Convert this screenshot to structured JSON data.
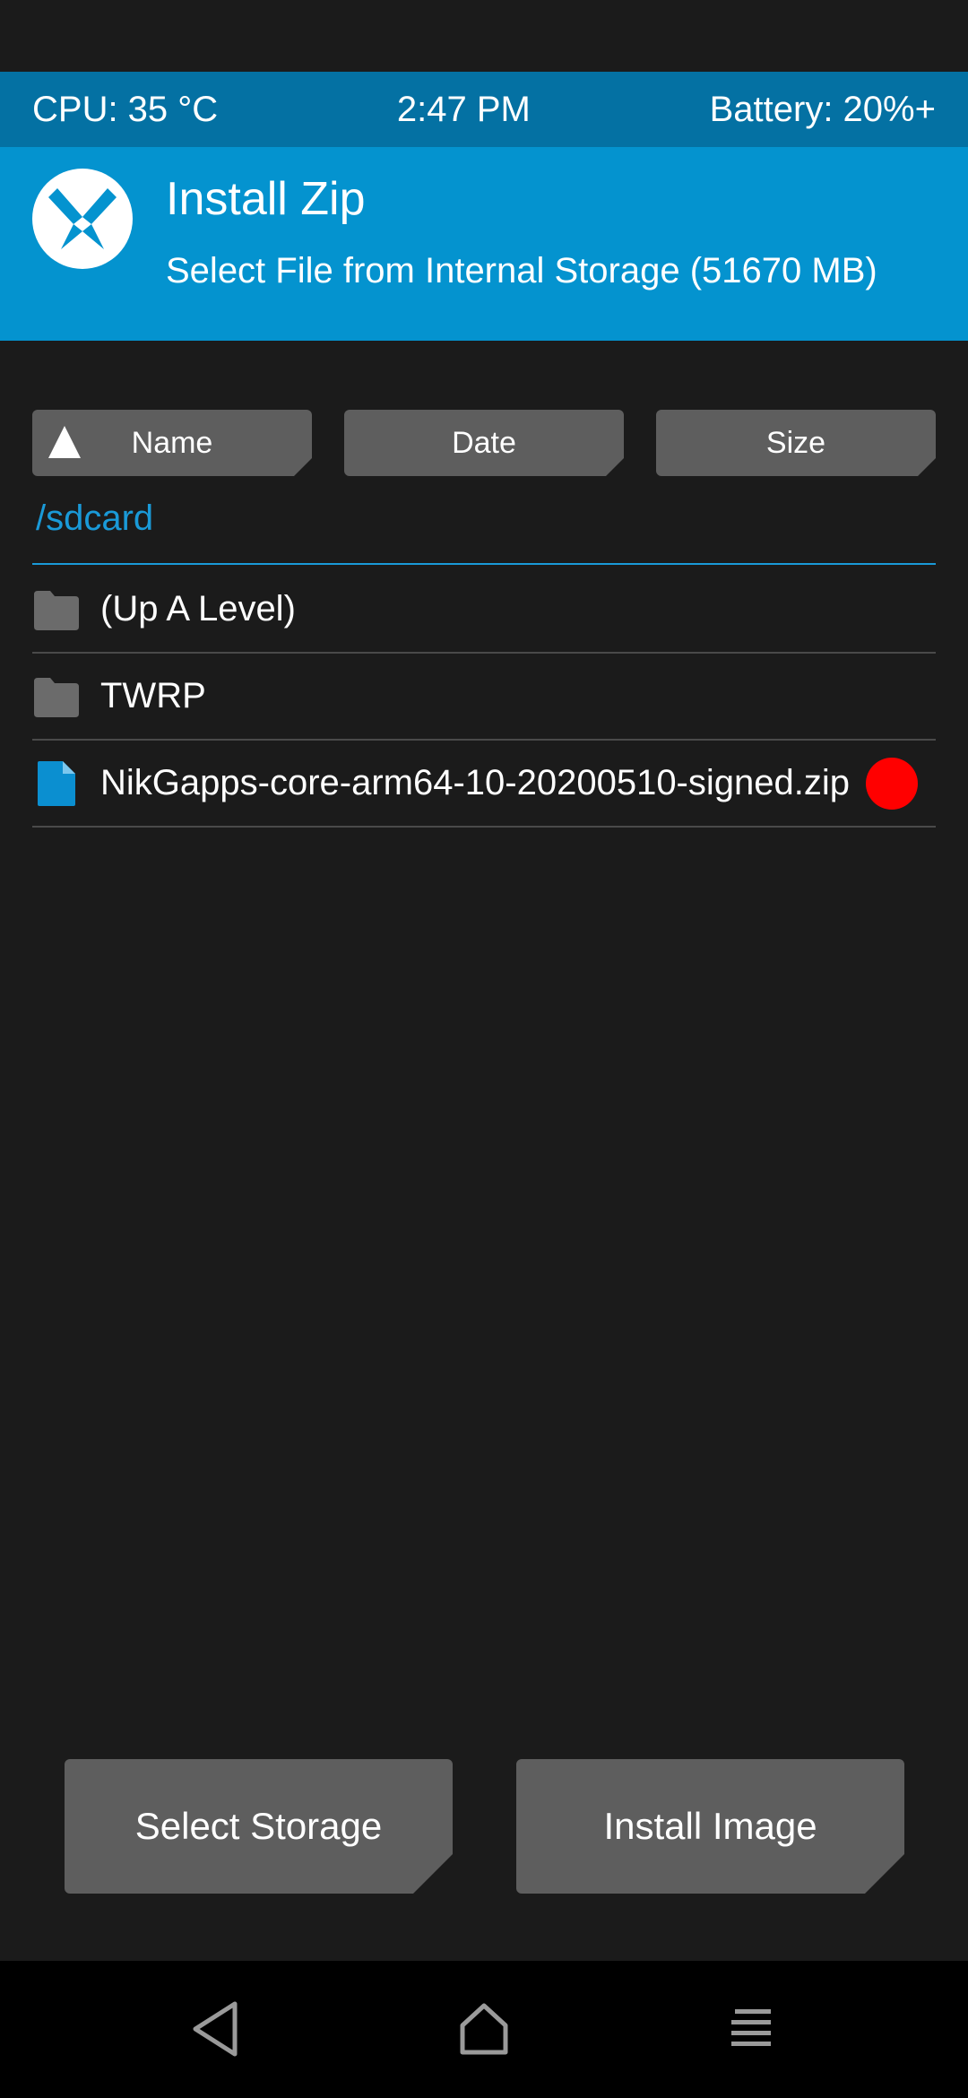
{
  "status_bar": {
    "cpu": "CPU: 35 °C",
    "time": "2:47 PM",
    "battery": "Battery: 20%+"
  },
  "header": {
    "logo_icon": "twrp-logo-icon",
    "title": "Install Zip",
    "subtitle": "Select File from Internal Storage (51670 MB)"
  },
  "sort_buttons": {
    "name": "Name",
    "date": "Date",
    "size": "Size",
    "active_sort": "name-ascending"
  },
  "path": "/sdcard",
  "files": [
    {
      "label": "(Up A Level)",
      "icon": "folder-icon"
    },
    {
      "label": "TWRP",
      "icon": "folder-icon"
    },
    {
      "label": "NikGapps-core-arm64-10-20200510-signed.zip",
      "icon": "file-icon",
      "indicator": "red-dot"
    }
  ],
  "actions": {
    "select_storage": "Select Storage",
    "install_image": "Install Image"
  },
  "navbar": {
    "back_icon": "back-icon",
    "home_icon": "home-icon",
    "menu_icon": "menu-icon"
  },
  "colors": {
    "accent": "#0493cf",
    "status_bar": "#0471a3",
    "background": "#1b1b1b",
    "button": "#5e5e5e",
    "file_icon": "#0b8fd0",
    "indicator": "#ff0000"
  }
}
